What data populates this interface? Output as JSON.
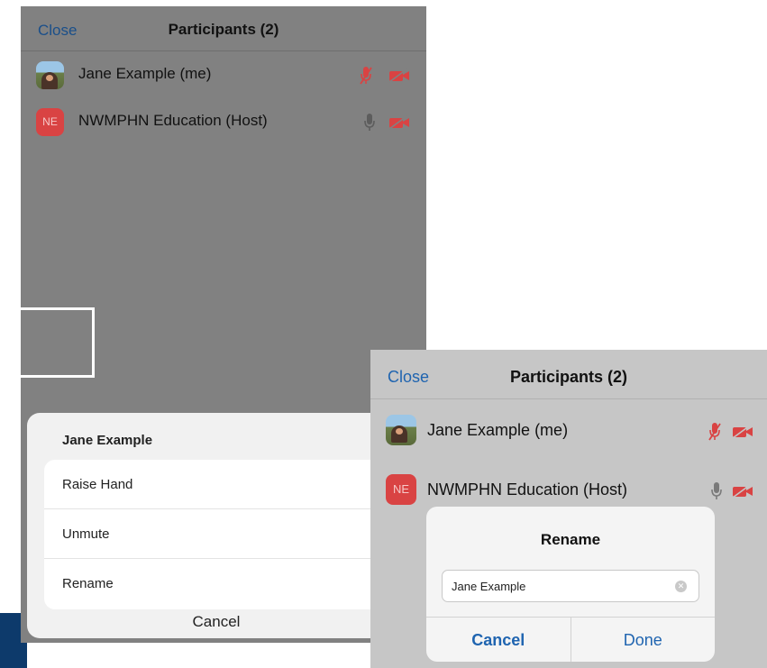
{
  "colors": {
    "accent": "#1f64b0",
    "muted_red": "#d94343",
    "host_badge": "#d94343"
  },
  "left": {
    "header": {
      "close_label": "Close",
      "title": "Participants (2)"
    },
    "participants": [
      {
        "name": "Jane Example (me)",
        "avatar": "photo",
        "mic": "muted",
        "video": "off"
      },
      {
        "name": "NWMPHN Education (Host)",
        "avatar_initials": "NE",
        "mic": "on",
        "video": "off"
      }
    ],
    "action_sheet": {
      "title": "Jane Example",
      "items": [
        "Raise Hand",
        "Unmute",
        "Rename"
      ],
      "cancel_label": "Cancel"
    }
  },
  "right": {
    "header": {
      "close_label": "Close",
      "title": "Participants (2)"
    },
    "participants": [
      {
        "name": "Jane Example (me)",
        "avatar": "photo",
        "mic": "muted",
        "video": "off"
      },
      {
        "name": "NWMPHN Education (Host)",
        "avatar_initials": "NE",
        "mic": "on",
        "video": "off"
      }
    ],
    "rename_dialog": {
      "title": "Rename",
      "input_value": "Jane Example",
      "cancel_label": "Cancel",
      "done_label": "Done"
    }
  }
}
